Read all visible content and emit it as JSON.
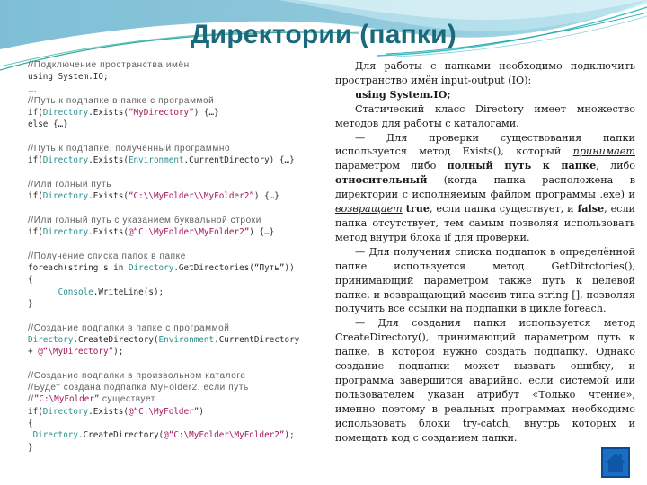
{
  "title": "Директории (папки)",
  "code": {
    "lines": [
      [
        {
          "t": "com",
          "v": "//Подключение пространства имён"
        }
      ],
      [
        {
          "t": "kw",
          "v": "using System.IO;"
        }
      ],
      [
        {
          "t": "com",
          "v": "…"
        }
      ],
      [
        {
          "t": "com",
          "v": "//Путь к подпапке в папке с программой"
        }
      ],
      [
        {
          "t": "kw",
          "v": "if("
        },
        {
          "t": "type",
          "v": "Directory"
        },
        {
          "t": "plain",
          "v": ".Exists("
        },
        {
          "t": "str",
          "v": "“MyDirectory”"
        },
        {
          "t": "plain",
          "v": ") {…}"
        }
      ],
      [
        {
          "t": "kw",
          "v": "else {…}"
        }
      ],
      [],
      [
        {
          "t": "com",
          "v": "//Путь к подпапке, полученный программно"
        }
      ],
      [
        {
          "t": "kw",
          "v": "if("
        },
        {
          "t": "type",
          "v": "Directory"
        },
        {
          "t": "plain",
          "v": ".Exists("
        },
        {
          "t": "type",
          "v": "Environment"
        },
        {
          "t": "plain",
          "v": ".CurrentDirectory) {…}"
        }
      ],
      [],
      [
        {
          "t": "com",
          "v": "//Или голный путь"
        }
      ],
      [
        {
          "t": "kw",
          "v": "if("
        },
        {
          "t": "type",
          "v": "Directory"
        },
        {
          "t": "plain",
          "v": ".Exists("
        },
        {
          "t": "str",
          "v": "“C:\\\\MyFolder\\\\MyFolder2”"
        },
        {
          "t": "plain",
          "v": ") {…}"
        }
      ],
      [],
      [
        {
          "t": "com",
          "v": "//Или голный путь с указанием буквальной строки"
        }
      ],
      [
        {
          "t": "kw",
          "v": "if("
        },
        {
          "t": "type",
          "v": "Directory"
        },
        {
          "t": "plain",
          "v": ".Exists("
        },
        {
          "t": "str",
          "v": "@“C:\\MyFolder\\MyFolder2”"
        },
        {
          "t": "plain",
          "v": ") {…}"
        }
      ],
      [],
      [
        {
          "t": "com",
          "v": "//Получение списка папок в папке"
        }
      ],
      [
        {
          "t": "kw",
          "v": "foreach(string s in "
        },
        {
          "t": "type",
          "v": "Directory"
        },
        {
          "t": "plain",
          "v": ".GetDirectories("
        },
        {
          "t": "plain",
          "v": "“Путь”"
        },
        {
          "t": "plain",
          "v": "))"
        }
      ],
      [
        {
          "t": "plain",
          "v": "{"
        }
      ],
      [
        {
          "t": "plain",
          "v": "      "
        },
        {
          "t": "type",
          "v": "Console"
        },
        {
          "t": "plain",
          "v": ".WriteLine(s);"
        }
      ],
      [
        {
          "t": "plain",
          "v": "}"
        }
      ],
      [],
      [
        {
          "t": "com",
          "v": "//Создание подпапки в папке с программой"
        }
      ],
      [
        {
          "t": "type",
          "v": "Directory"
        },
        {
          "t": "plain",
          "v": ".CreateDirectory("
        },
        {
          "t": "type",
          "v": "Environment"
        },
        {
          "t": "plain",
          "v": ".CurrentDirectory"
        }
      ],
      [
        {
          "t": "plain",
          "v": "+ "
        },
        {
          "t": "str",
          "v": "@“\\MyDirectory”"
        },
        {
          "t": "plain",
          "v": ");"
        }
      ],
      [],
      [
        {
          "t": "com",
          "v": "//Создание подпапки в произвольном каталоге"
        }
      ],
      [
        {
          "t": "com",
          "v": "//Будет создана подпапка MyFolder2, если путь"
        }
      ],
      [
        {
          "t": "com",
          "v": "//"
        },
        {
          "t": "str",
          "v": "”C:\\MyFolder”"
        },
        {
          "t": "com",
          "v": " существует"
        }
      ],
      [
        {
          "t": "kw",
          "v": "if("
        },
        {
          "t": "type",
          "v": "Directory"
        },
        {
          "t": "plain",
          "v": ".Exists("
        },
        {
          "t": "str",
          "v": "@“C:\\MyFolder”"
        },
        {
          "t": "plain",
          "v": ")"
        }
      ],
      [
        {
          "t": "plain",
          "v": "{"
        }
      ],
      [
        {
          "t": "plain",
          "v": " "
        },
        {
          "t": "type",
          "v": "Directory"
        },
        {
          "t": "plain",
          "v": ".CreateDirectory("
        },
        {
          "t": "str",
          "v": "@“C:\\MyFolder\\MyFolder2”"
        },
        {
          "t": "plain",
          "v": ");"
        }
      ],
      [
        {
          "t": "plain",
          "v": "}"
        }
      ]
    ]
  },
  "prose": {
    "paragraphs": [
      [
        {
          "s": "n",
          "v": "Для работы с папками необходимо подключить пространство имён input-output (IO):"
        }
      ],
      [
        {
          "s": "b",
          "v": "using System.IO;"
        }
      ],
      [
        {
          "s": "n",
          "v": "Статический класс Directory имеет множество методов для работы с каталогами."
        }
      ],
      [
        {
          "s": "n",
          "v": "— Для проверки существования папки используется метод Exists(), который "
        },
        {
          "s": "ui",
          "v": "принимает"
        },
        {
          "s": "n",
          "v": " параметром либо "
        },
        {
          "s": "b",
          "v": "полный путь к папке"
        },
        {
          "s": "n",
          "v": ", либо "
        },
        {
          "s": "b",
          "v": "относительный"
        },
        {
          "s": "n",
          "v": " (когда папка расположена в директории с исполняемым файлом программы .exe) и "
        },
        {
          "s": "ui",
          "v": "возвращает"
        },
        {
          "s": "n",
          "v": " "
        },
        {
          "s": "b",
          "v": "true"
        },
        {
          "s": "n",
          "v": ", если папка существует, и "
        },
        {
          "s": "b",
          "v": "false"
        },
        {
          "s": "n",
          "v": ", если папка отсутствует, тем самым позволяя использовать метод внутри блока if для проверки."
        }
      ],
      [
        {
          "s": "n",
          "v": "— Для получения списка подпапок в определённой папке используется метод GetDitrctories(), принимающий параметром также путь к целевой папке, и возвращающий массив типа string [], позволяя получить все ссылки на подпапки в цикле foreach."
        }
      ],
      [
        {
          "s": "n",
          "v": "— Для создания папки используется метод CreateDirectory(), принимающий параметром путь к папке, в которой нужно создать подпапку. Однако создание подпапки может вызвать ошибку, и программа завершится аварийно, если системой или пользователем указан атрибут «Только чтение», именно поэтому в реальных программах необходимо использовать блоки try-catch, внутрь которых и помещать код с созданием папки."
        }
      ]
    ]
  },
  "home_button": {
    "icon": "home-icon"
  },
  "colors": {
    "title": "#1b6a7c",
    "banner_top": "#7fbfd6",
    "banner_accent": "#3bbfd0",
    "code_type": "#2b8f8f",
    "code_string": "#a3155c",
    "code_comment": "#5f5f5f",
    "home_button": "#1a6ec4"
  }
}
